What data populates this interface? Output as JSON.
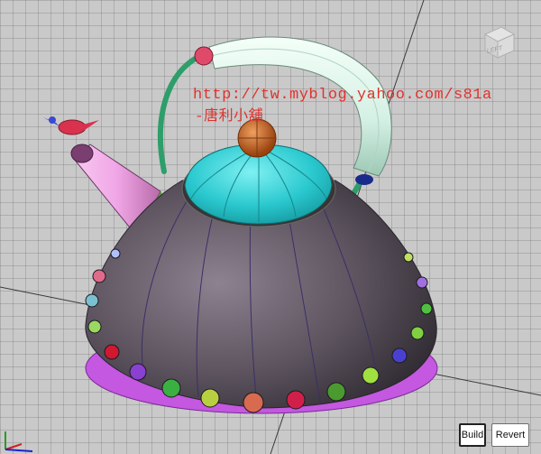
{
  "viewport": {
    "watermark_line1": "http://tw.myblog.yahoo.com/s81a",
    "watermark_line2": "-唐利小舖",
    "viewcube_label": "LEFT"
  },
  "buttons": {
    "build_label": "Build",
    "revert_label": "Revert"
  },
  "icons": {
    "viewcube": "viewcube-icon",
    "axis": "axis-triad-icon"
  },
  "colors": {
    "background": "#c9c9c9",
    "kettle_body": "#5e5560",
    "lid": "#2ac9cf",
    "knob": "#c8661e",
    "spout": "#f0a6e6",
    "handle_grip": "#d4f0e4",
    "handle_wire": "#2e9e6a",
    "bird": "#d8324e",
    "base_ring": "#c458e0",
    "watermark": "#e0322d"
  }
}
